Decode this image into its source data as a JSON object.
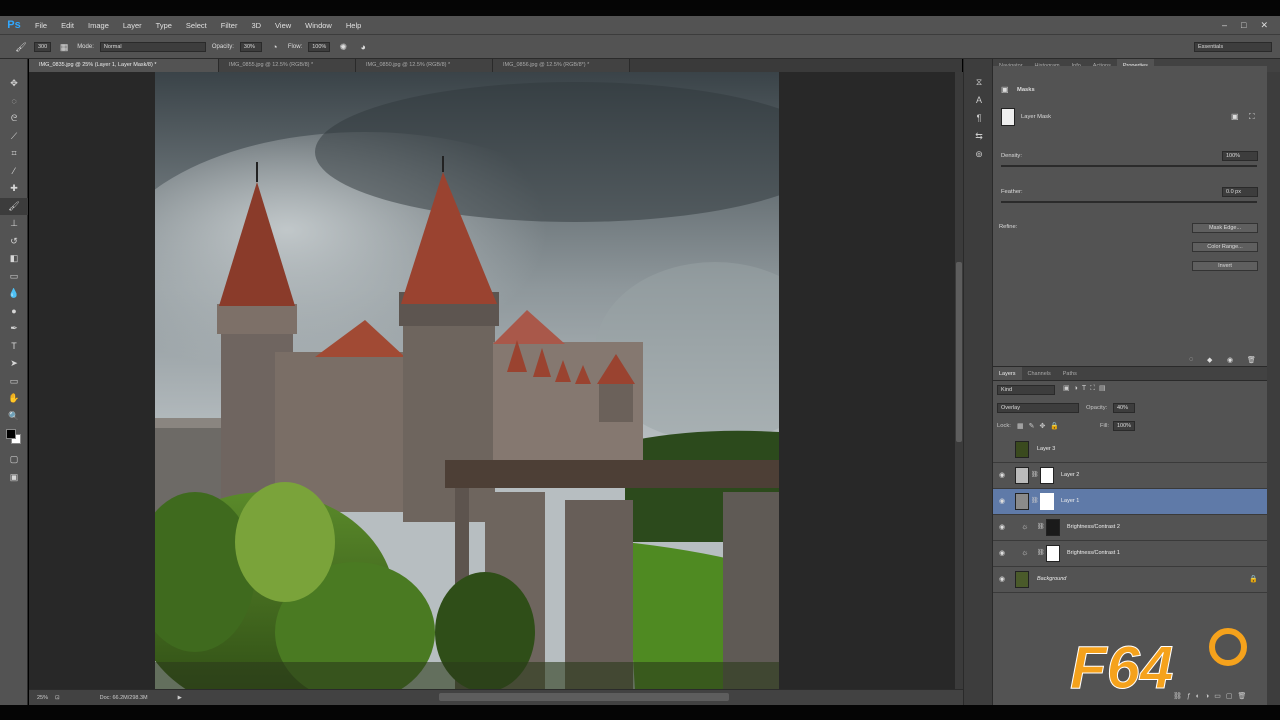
{
  "app": {
    "logo": "Ps",
    "menu": [
      "File",
      "Edit",
      "Image",
      "Layer",
      "Type",
      "Select",
      "Filter",
      "3D",
      "View",
      "Window",
      "Help"
    ],
    "window_controls": [
      "–",
      "□",
      "✕"
    ]
  },
  "options_bar": {
    "mode_label": "Mode:",
    "mode_value": "Normal",
    "opacity_label": "Opacity:",
    "opacity_value": "30%",
    "flow_label": "Flow:",
    "flow_value": "100%",
    "brush_size": "300",
    "workspace": "Essentials"
  },
  "document_tabs": [
    {
      "label": "IMG_0835.jpg @ 25% (Layer 1, Layer Mask/8) *",
      "active": true
    },
    {
      "label": "IMG_0855.jpg @ 12.5% (RGB/8) *",
      "active": false
    },
    {
      "label": "IMG_0850.jpg @ 12.5% (RGB/8) *",
      "active": false
    },
    {
      "label": "IMG_0856.jpg @ 12.5% (RGB/8*) *",
      "active": false
    }
  ],
  "status_bar": {
    "zoom": "25%",
    "doc_size": "Doc: 66.2M/298.3M"
  },
  "panel_tabs_top": [
    "Navigator",
    "Histogram",
    "Info",
    "Actions",
    "Properties"
  ],
  "properties": {
    "section": "Masks",
    "mask_type": "Layer Mask",
    "density_label": "Density:",
    "density_value": "100%",
    "feather_label": "Feather:",
    "feather_value": "0.0 px",
    "refine_label": "Refine:",
    "buttons": [
      "Mask Edge...",
      "Color Range...",
      "Invert"
    ]
  },
  "layers_tabs": [
    "Layers",
    "Channels",
    "Paths"
  ],
  "layers_controls": {
    "filter_kind": "Kind",
    "blend_mode": "Overlay",
    "opacity_label": "Opacity:",
    "opacity_value": "40%",
    "lock_label": "Lock:",
    "fill_label": "Fill:",
    "fill_value": "100%"
  },
  "layers": [
    {
      "name": "Layer 3",
      "visible": false,
      "selected": false
    },
    {
      "name": "Layer 2",
      "visible": true,
      "selected": false
    },
    {
      "name": "Layer 1",
      "visible": true,
      "selected": true
    },
    {
      "name": "Brightness/Contrast 2",
      "visible": true,
      "selected": false
    },
    {
      "name": "Brightness/Contrast 1",
      "visible": true,
      "selected": false
    },
    {
      "name": "Background",
      "visible": true,
      "selected": false
    }
  ],
  "watermark": {
    "text": "F64"
  },
  "colors": {
    "chrome": "#535353",
    "canvas_bg": "#282828",
    "selection": "#5f7aa8",
    "accent": "#31a8ff",
    "watermark_orange": "#f5a21c"
  }
}
